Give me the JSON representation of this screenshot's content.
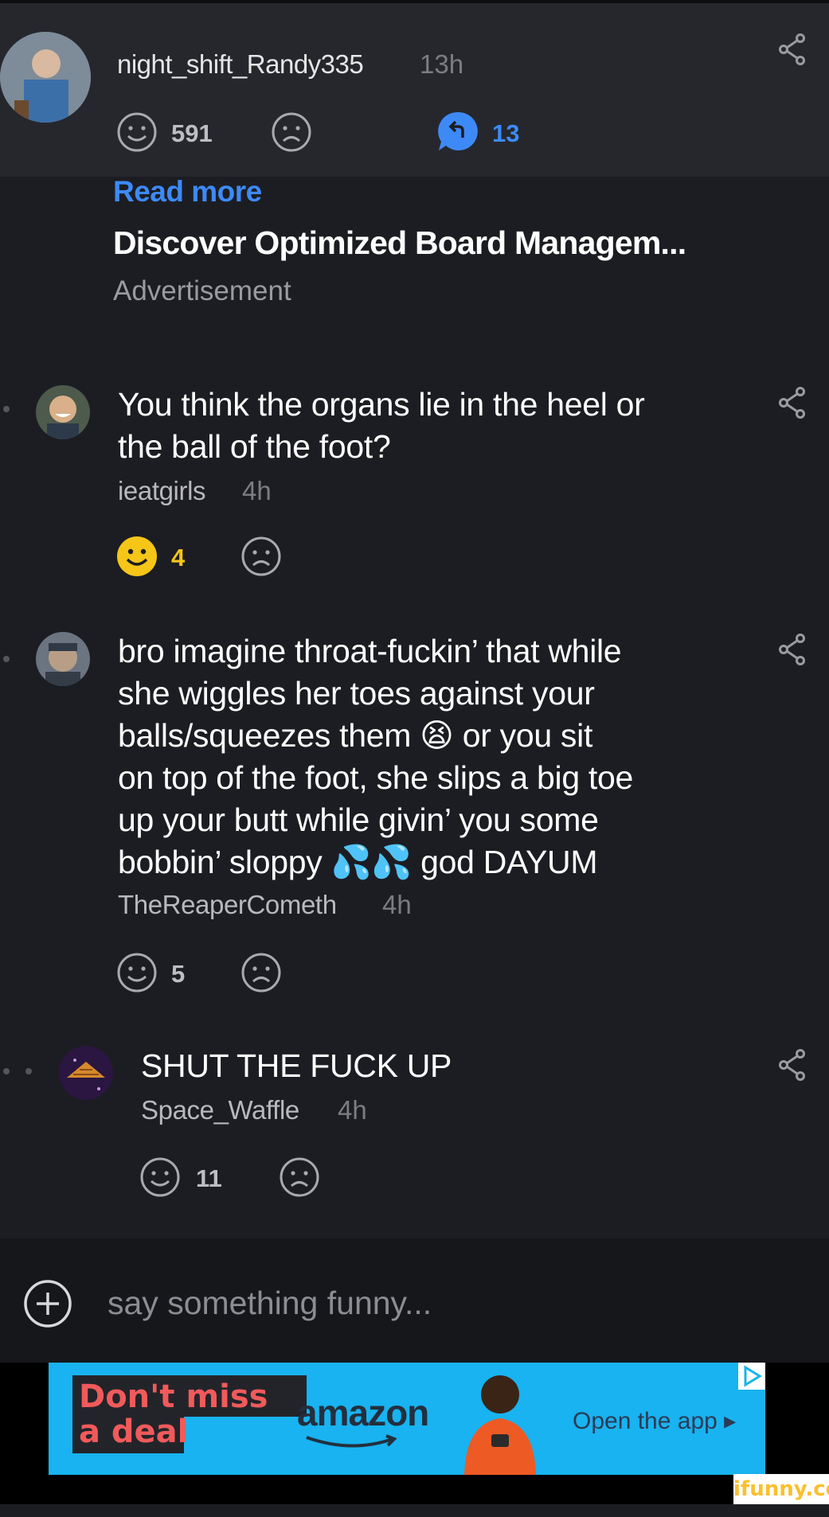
{
  "top_comment": {
    "username": "night_shift_Randy335",
    "time": "13h",
    "likes": "591",
    "replies": "13"
  },
  "ad": {
    "read_more": "Read more",
    "title": "Discover Optimized Board Managem...",
    "label": "Advertisement"
  },
  "replies": [
    {
      "lines": [
        "You think the organs lie in the heel or",
        "the ball of the foot?"
      ],
      "author": "ieatgirls",
      "time": "4h",
      "likes": "4",
      "liked": true
    },
    {
      "lines": [
        "bro imagine throat-fuckin’ that while",
        "she wiggles her toes against your",
        "balls/squeezes them 😫 or you sit",
        "on top of the foot, she slips a big toe",
        "up your butt while givin’ you some",
        "bobbin’ sloppy 💦💦 god DAYUM"
      ],
      "author": "TheReaperCometh",
      "time": "4h",
      "likes": "5",
      "liked": false
    },
    {
      "lines": [
        "SHUT THE FUCK UP"
      ],
      "author": "Space_Waffle",
      "time": "4h",
      "likes": "11",
      "liked": false
    }
  ],
  "composer": {
    "placeholder": "say something funny..."
  },
  "banner": {
    "line1": "Don't miss",
    "line2": "a deal",
    "brand": "amazon",
    "cta": "Open the app ▸"
  },
  "watermark": "ifunny.co",
  "colors": {
    "background": "#1c1d22",
    "top_thread_bg": "#26272d",
    "accent_blue": "#3d8af7",
    "liked_yellow": "#f5c518",
    "banner_blue": "#18b3f0"
  },
  "icons": {
    "like": "smile-face-icon",
    "dislike": "frown-face-icon",
    "reply": "reply-bubble-icon",
    "share": "share-icon",
    "add": "plus-circle-icon"
  }
}
